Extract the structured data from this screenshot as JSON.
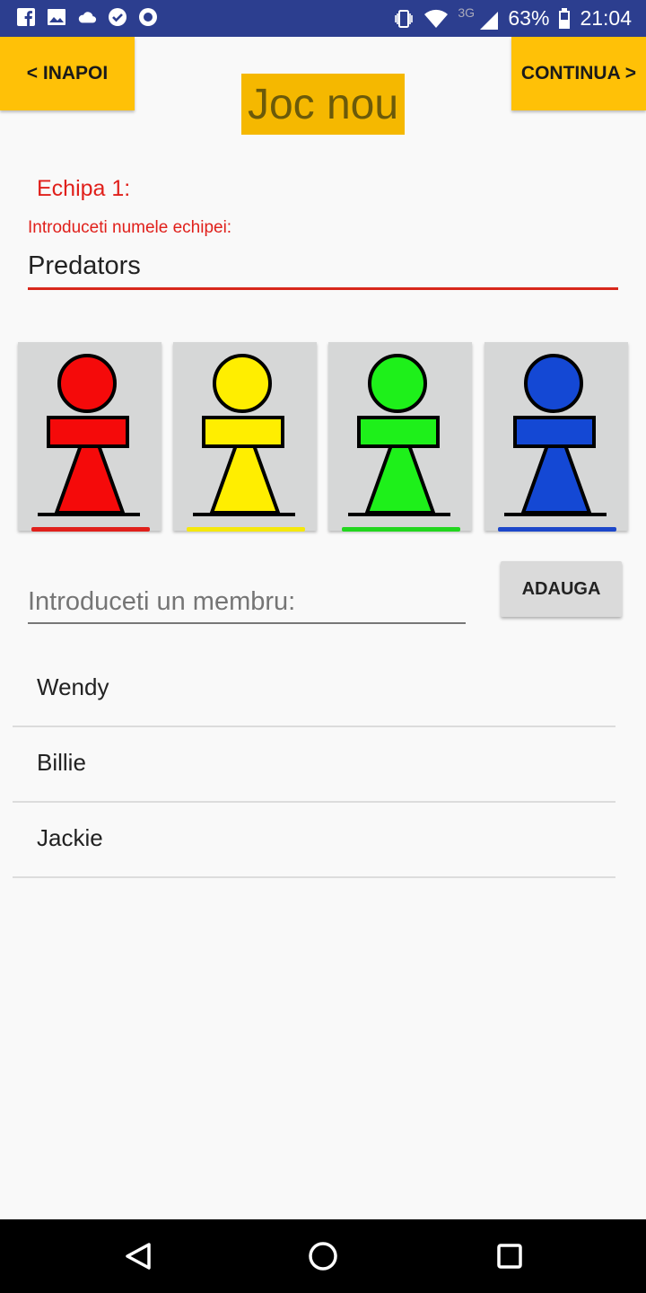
{
  "status_bar": {
    "network": "3G",
    "battery": "63%",
    "time": "21:04",
    "icons": [
      "facebook-icon",
      "image-icon",
      "cloud-icon",
      "check-icon",
      "record-icon",
      "vibrate-icon",
      "wifi-icon",
      "signal-icon",
      "battery-icon"
    ]
  },
  "header": {
    "back_label": "< INAPOI",
    "continue_label": "CONTINUA >",
    "title": "Joc nou"
  },
  "team": {
    "label": "Echipa 1:",
    "name_field_label": "Introduceti numele echipei:",
    "name_value": "Predators",
    "accent_color": "#e0201b"
  },
  "pawns": [
    {
      "color_name": "red",
      "color": "#f50a0a",
      "bar": "#e0201b"
    },
    {
      "color_name": "yellow",
      "color": "#ffee00",
      "bar": "#f5e80c"
    },
    {
      "color_name": "green",
      "color": "#1ef01a",
      "bar": "#22d61e"
    },
    {
      "color_name": "blue",
      "color": "#1448d4",
      "bar": "#1d47c9"
    }
  ],
  "member_input": {
    "placeholder": "Introduceti un membru:",
    "value": ""
  },
  "add_button_label": "ADAUGA",
  "members": [
    "Wendy",
    "Billie",
    "Jackie"
  ],
  "nav": {
    "icons": [
      "back-icon",
      "home-icon",
      "recents-icon"
    ]
  }
}
